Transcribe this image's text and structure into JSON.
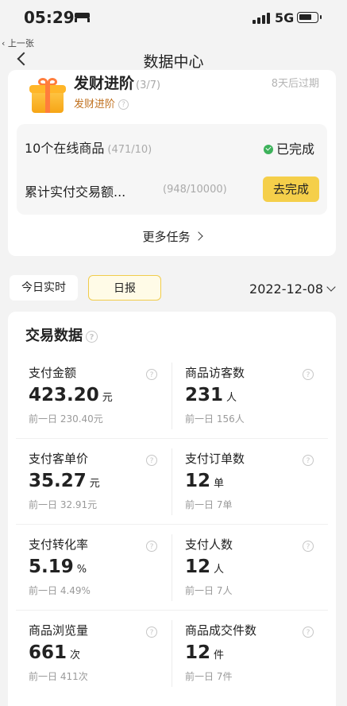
{
  "status_bar": {
    "time": "05:29",
    "network": "5G"
  },
  "back_app_label": "上一张",
  "nav": {
    "title": "数据中心"
  },
  "task": {
    "name": "发财进阶",
    "progress": "(3/7)",
    "level": "发财进阶",
    "expire": "8天后过期",
    "subtasks": [
      {
        "name": "10个在线商品",
        "count": "(471/10)",
        "status": "已完成"
      },
      {
        "name": "累计实付交易额...",
        "count": "(948/10000)",
        "button": "去完成"
      }
    ],
    "more": "更多任务"
  },
  "tabs": {
    "realtime": "今日实时",
    "daily": "日报",
    "active": "daily"
  },
  "date": "2022-12-08",
  "data_section": {
    "title": "交易数据",
    "metrics": [
      {
        "label": "支付金额",
        "value": "423.20",
        "unit": "元",
        "prev": "前一日 230.40元"
      },
      {
        "label": "商品访客数",
        "value": "231",
        "unit": "人",
        "prev": "前一日 156人"
      },
      {
        "label": "支付客单价",
        "value": "35.27",
        "unit": "元",
        "prev": "前一日 32.91元"
      },
      {
        "label": "支付订单数",
        "value": "12",
        "unit": "单",
        "prev": "前一日 7单"
      },
      {
        "label": "支付转化率",
        "value": "5.19",
        "unit": "%",
        "prev": "前一日 4.49%"
      },
      {
        "label": "支付人数",
        "value": "12",
        "unit": "人",
        "prev": "前一日 7人"
      },
      {
        "label": "商品浏览量",
        "value": "661",
        "unit": "次",
        "prev": "前一日 411次"
      },
      {
        "label": "商品成交件数",
        "value": "12",
        "unit": "件",
        "prev": "前一日 7件"
      }
    ]
  },
  "colors": {
    "accent": "#f5cf4a",
    "success": "#3db25b",
    "level_text": "#c0711f"
  }
}
